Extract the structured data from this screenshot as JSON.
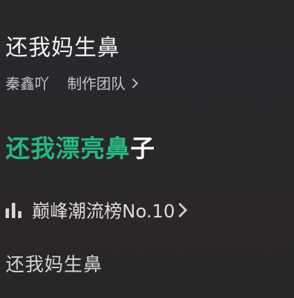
{
  "song": {
    "title": "还我妈生鼻",
    "artist": "秦鑫吖",
    "team_label": "制作团队"
  },
  "lyrics": {
    "current_played": "还我漂亮鼻",
    "current_unplayed": "子",
    "next": "还我妈生鼻"
  },
  "chart": {
    "icon": "bar-chart-icon",
    "label": "巅峰潮流榜No.10"
  },
  "colors": {
    "background": "#2a272b",
    "accent": "#26b87f",
    "text_primary": "#f2f2f2"
  }
}
